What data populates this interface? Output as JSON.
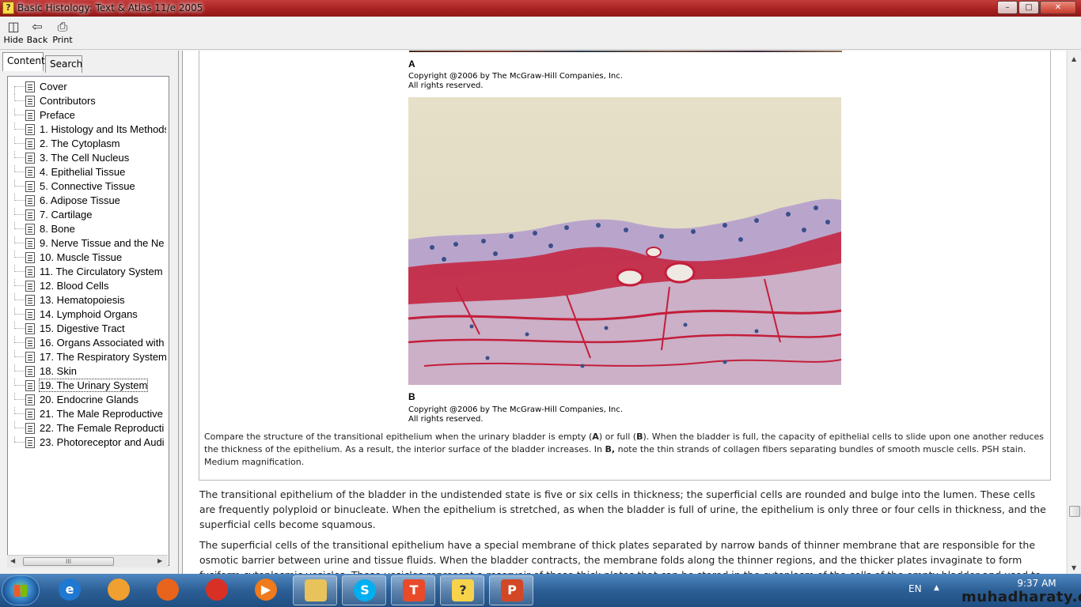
{
  "window": {
    "title": "Basic Histology: Text & Atlas 11/e 2005",
    "min_label": "–",
    "max_label": "□",
    "close_label": "✕"
  },
  "toolbar": {
    "hide_label": "Hide",
    "back_label": "Back",
    "print_label": "Print"
  },
  "nav": {
    "tabs": [
      "Contents",
      "Search"
    ],
    "items": [
      "Cover",
      "Contributors",
      "Preface",
      "1. Histology and Its Methods",
      "2. The Cytoplasm",
      "3. The Cell Nucleus",
      "4. Epithelial Tissue",
      "5. Connective Tissue",
      "6. Adipose Tissue",
      "7. Cartilage",
      "8. Bone",
      "9. Nerve Tissue and the Ne",
      "10. Muscle Tissue",
      "11. The Circulatory System",
      "12. Blood Cells",
      "13. Hematopoiesis",
      "14. Lymphoid Organs",
      "15. Digestive Tract",
      "16. Organs Associated with",
      "17. The Respiratory System",
      "18. Skin",
      "19. The Urinary System",
      "20. Endocrine Glands",
      "21. The Male Reproductive",
      "22. The Female Reproducti",
      "23. Photoreceptor and Audi"
    ],
    "selected_index": 21,
    "scroll_thumb_label": "III"
  },
  "figure": {
    "label_a": "A",
    "label_b": "B",
    "copyright_line1": "Copyright @2006 by The McGraw-Hill Companies, Inc.",
    "copyright_line2": "All rights reserved.",
    "caption_parts": [
      "Compare the structure of the transitional epithelium when the urinary bladder is empty (",
      "A",
      ") or full (",
      "B",
      "). When the bladder is full, the capacity of epithelial cells to slide upon one another reduces the thickness of the epithelium. As a result, the interior surface of the bladder increases. In ",
      "B,",
      " note the thin strands of collagen fibers separating bundles of smooth muscle cells. PSH stain. Medium magnification."
    ]
  },
  "body_text": {
    "para1": "The transitional epithelium of the bladder in the undistended state is five or six cells in thickness; the superficial cells are rounded and bulge into the lumen. These cells are frequently polyploid or binucleate. When the epithelium is stretched, as when the bladder is full of urine, the epithelium is only three or four cells in thickness, and the superficial cells become squamous.",
    "para2": "The superficial cells of the transitional epithelium have a special membrane of thick plates separated by narrow bands of thinner membrane that are responsible for the osmotic barrier between urine and tissue fluids. When the bladder contracts, the membrane folds along the thinner regions, and the thicker plates invaginate to form fusiform cytoplasmic vesicles. These vesicles represent a reservoir of these thick plates that can be stored in the cytoplasm of the cells of the empty bladder and used to"
  },
  "taskbar": {
    "apps": [
      "internet-explorer",
      "orange-app",
      "firefox",
      "chrome",
      "media-player",
      "file-explorer",
      "skype",
      "t-app",
      "help-viewer",
      "powerpoint"
    ],
    "active_index": 8,
    "language": "EN",
    "time": "9:37 AM",
    "watermark": "muhadharaty.com"
  },
  "colors": {
    "titlebar": "#b52a2a",
    "taskbar": "#2c5f96",
    "tissue_stain": "#c41e3a",
    "epithelium": "#b9a5cc"
  }
}
